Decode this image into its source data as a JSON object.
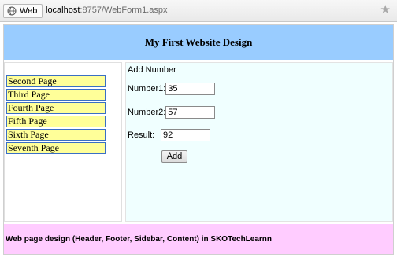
{
  "browser": {
    "tab_label": "Web",
    "url_host": "localhost",
    "url_path": ":8757/WebForm1.aspx",
    "star_icon": "star-icon"
  },
  "header": {
    "title": "My First Website Design"
  },
  "sidebar": {
    "items": [
      {
        "label": "Second Page"
      },
      {
        "label": "Third Page"
      },
      {
        "label": "Fourth Page"
      },
      {
        "label": "Fifth Page"
      },
      {
        "label": "Sixth Page"
      },
      {
        "label": "Seventh Page"
      }
    ]
  },
  "content": {
    "title": "Add Number",
    "number1_label": "Number1:",
    "number1_value": "35",
    "number2_label": "Number2:",
    "number2_value": "57",
    "result_label": "Result:",
    "result_value": "92",
    "add_label": "Add"
  },
  "footer": {
    "text": "Web page design (Header, Footer, Sidebar, Content) in SKOTechLearnn"
  },
  "colors": {
    "header_bg": "#99ccff",
    "menu_bg": "#ffff99",
    "content_bg": "#f0ffff",
    "footer_bg": "#ffccff"
  }
}
